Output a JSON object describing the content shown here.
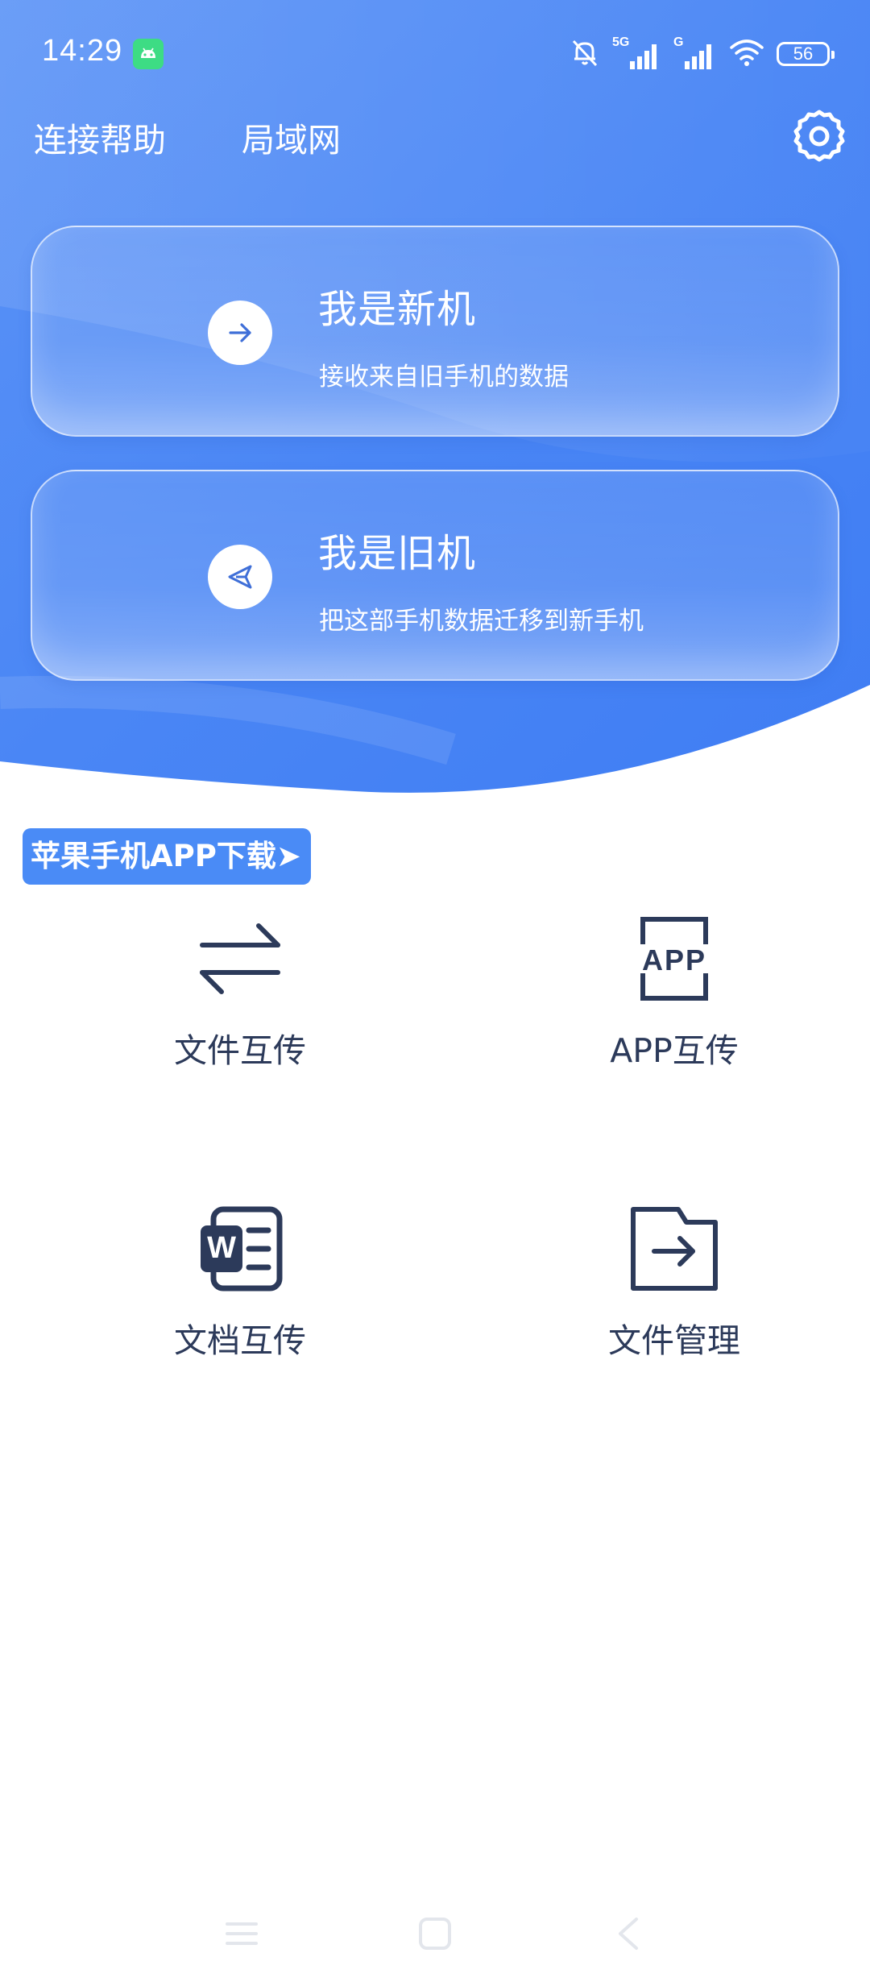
{
  "status_bar": {
    "time": "14:29",
    "network_1": "5G",
    "network_2": "G",
    "battery": "56"
  },
  "top_nav": {
    "help_label": "连接帮助",
    "lan_label": "局域网"
  },
  "cards": {
    "new_phone": {
      "title": "我是新机",
      "subtitle": "接收来自旧手机的数据"
    },
    "old_phone": {
      "title": "我是旧机",
      "subtitle": "把这部手机数据迁移到新手机"
    }
  },
  "ios_download": {
    "label": "苹果手机APP下载➤"
  },
  "features": {
    "file_transfer": "文件互传",
    "app_transfer": "APP互传",
    "app_icon_text": "APP",
    "doc_transfer": "文档互传",
    "doc_icon_text": "W",
    "file_manage": "文件管理"
  },
  "colors": {
    "hero_blue": "#4a86f5",
    "hero_blue_dark": "#3f7df3",
    "icon_navy": "#2c3a5a",
    "badge_blue": "#4a8bf6",
    "android_green": "#3ddc84"
  },
  "icons": {
    "status": [
      "android-icon",
      "bell-off-icon",
      "signal-5g-icon",
      "signal-g-icon",
      "wifi-icon",
      "battery-icon"
    ],
    "nav": [
      "settings-gear-icon"
    ],
    "cards": [
      "arrow-right-icon",
      "send-icon"
    ],
    "features": [
      "swap-arrows-icon",
      "app-box-icon",
      "word-doc-icon",
      "folder-export-icon"
    ],
    "system": [
      "menu-icon",
      "home-icon",
      "back-icon"
    ]
  }
}
